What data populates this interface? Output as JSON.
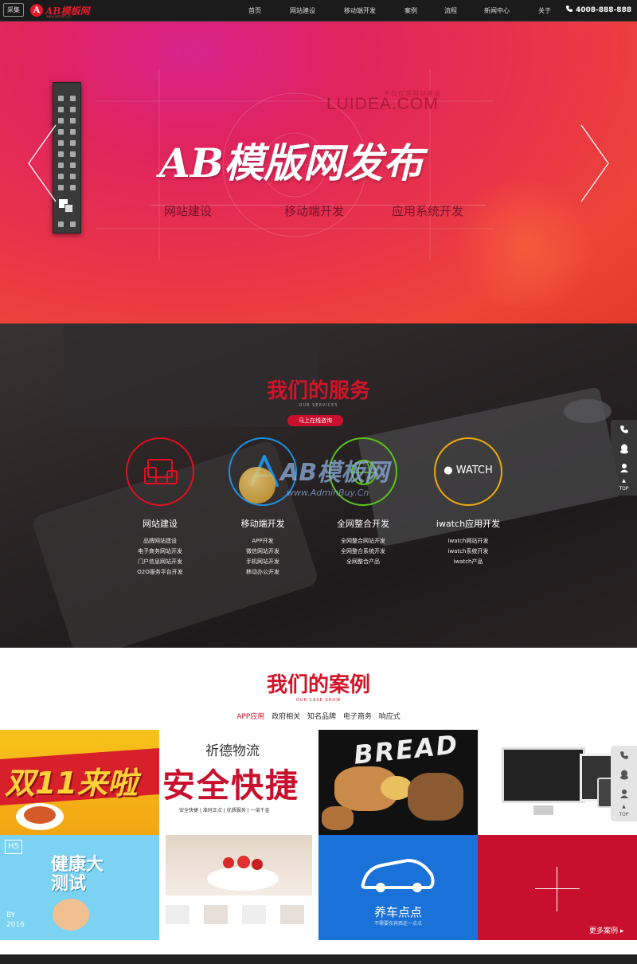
{
  "nav": {
    "collect_label": "采集",
    "logo_mark": "A",
    "logo_text": "AB模板网",
    "logo_sub": "www.admin5.cn",
    "items": [
      "首页",
      "网站建设",
      "移动端开发",
      "案例",
      "流程",
      "新闻中心",
      "关于"
    ],
    "phone": "4008-888-888"
  },
  "hero": {
    "tagline": "不仅仅是网站建设",
    "brand": "LUIDEA.COM",
    "title": "AB模版网发布",
    "subtitles": [
      "网站建设",
      "移动端开发",
      "应用系统开发"
    ]
  },
  "services": {
    "title": "我们的服务",
    "subtitle": "OUR SERVICES",
    "consult_button": "马上在线咨询",
    "items": [
      {
        "title": "网站建设",
        "color": "#e01020",
        "icon": "monitor-devices-icon",
        "lines": [
          "品牌网站建设",
          "电子商务网站开发",
          "门户信息网站开发",
          "O2O服务平台开发"
        ]
      },
      {
        "title": "移动端开发",
        "color": "#1e8fe0",
        "icon": "app-store-icon",
        "lines": [
          "APP开发",
          "微信网站开发",
          "手机网站开发",
          "移动办公开发"
        ]
      },
      {
        "title": "全网整合开发",
        "color": "#5dc21e",
        "icon": "globe-icon",
        "lines": [
          "全网整合网站开发",
          "全网整合系统开发",
          "全网整合产品"
        ]
      },
      {
        "title": "iwatch应用开发",
        "color": "#f0a80e",
        "icon": "apple-watch-icon",
        "icon_text": "WATCH",
        "lines": [
          "iwatch网站开发",
          "iwatch系统开发",
          "iwatch产品"
        ]
      }
    ],
    "watermark": {
      "text": "AB模板网",
      "url": "www.AdminBuy.Cn"
    }
  },
  "side_toolbar": {
    "top_label": "TOP"
  },
  "cases": {
    "title": "我们的案例",
    "subtitle": "OUR CASE SHOW",
    "tabs": [
      "APP应用",
      "政府相关",
      "知名品牌",
      "电子商务",
      "响应式"
    ],
    "active_tab": 0,
    "items": [
      {
        "kind": "promo",
        "big_text": "双11来啦"
      },
      {
        "kind": "logistics",
        "heading": "祈德物流",
        "slogan": "安全快捷",
        "features": [
          "安全快捷",
          "准时正点",
          "优质服务",
          "一诺千金"
        ]
      },
      {
        "kind": "bread",
        "word": "BREAD"
      },
      {
        "kind": "devices"
      },
      {
        "kind": "health",
        "badge": "H5",
        "big_text": "健康大测试",
        "year_label": "BY",
        "year": "2016"
      },
      {
        "kind": "cake"
      },
      {
        "kind": "car",
        "title": "养车点点",
        "slogan": "不需要东奔西走一点点"
      },
      {
        "kind": "more",
        "label": "更多案例"
      }
    ]
  },
  "colors": {
    "brand_red": "#d0152a",
    "hero_red": "#e8334a",
    "dark_bg": "#2b2526"
  }
}
